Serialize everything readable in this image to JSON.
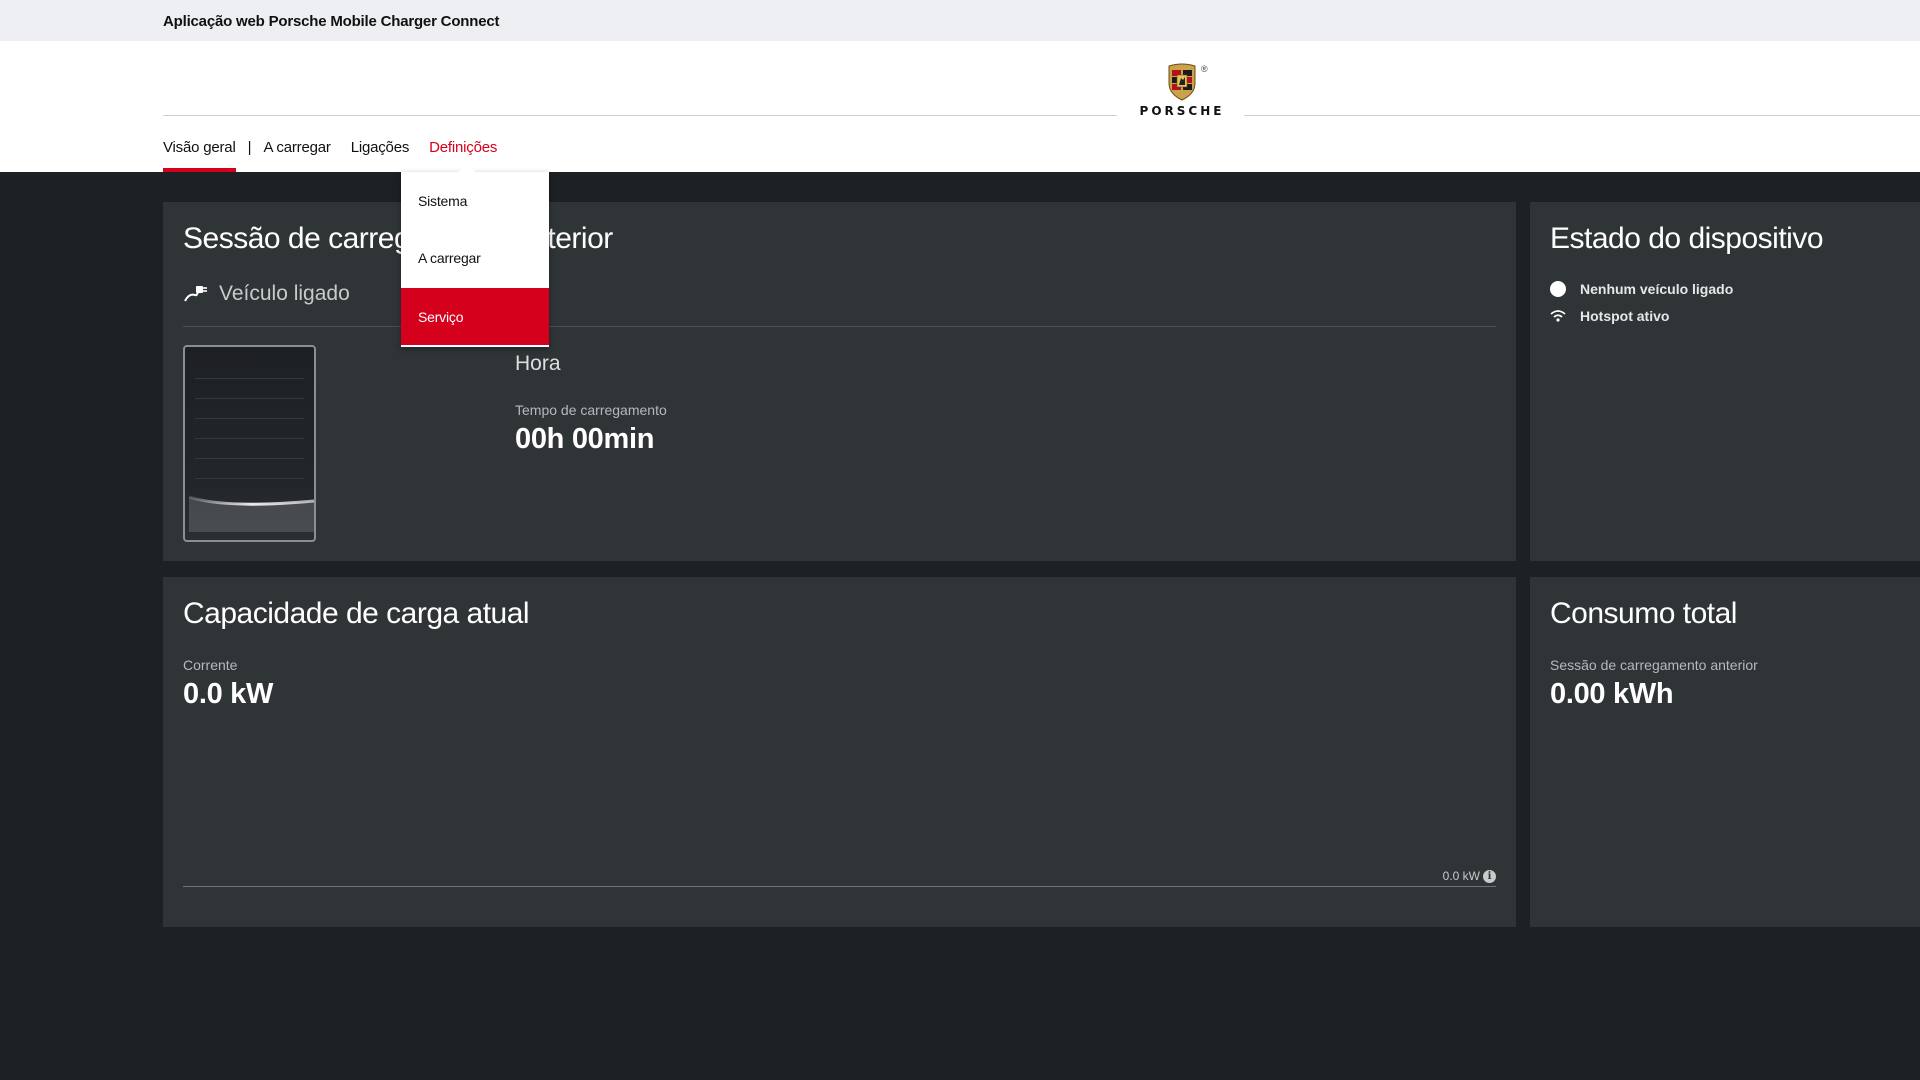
{
  "app": {
    "title": "Aplicação web Porsche Mobile Charger Connect"
  },
  "brand": {
    "wordmark": "PORSCHE",
    "registered": "®",
    "accent_color": "#d5001c"
  },
  "nav": {
    "items": [
      {
        "label": "Visão geral",
        "active": true
      },
      {
        "label": "A carregar"
      },
      {
        "label": "Ligações"
      },
      {
        "label": "Definições",
        "open": true
      }
    ],
    "separator": "|"
  },
  "settings_menu": {
    "items": [
      {
        "label": "Sistema"
      },
      {
        "label": "A carregar"
      },
      {
        "label": "Serviço",
        "highlighted": true
      }
    ]
  },
  "last_session": {
    "title": "Sessão de carregamento anterior",
    "vehicle_status": "Veículo ligado",
    "vehicle_icon": "plug-icon",
    "time_heading": "Hora",
    "charge_time_label": "Tempo de carregamento",
    "charge_time_value": "00h 00min"
  },
  "device_status": {
    "title": "Estado do dispositivo",
    "rows": [
      {
        "icon": "status-dot-icon",
        "label": "Nenhum veículo ligado"
      },
      {
        "icon": "wifi-icon",
        "label": "Hotspot ativo"
      }
    ]
  },
  "current_capacity": {
    "title": "Capacidade de carga atual",
    "label": "Corrente",
    "value": "0.0 kW",
    "bar_max_label": "0.0 kW",
    "info_icon": "info-icon"
  },
  "total_consumption": {
    "title": "Consumo total",
    "label": "Sessão de carregamento anterior",
    "value": "0.00 kWh"
  }
}
